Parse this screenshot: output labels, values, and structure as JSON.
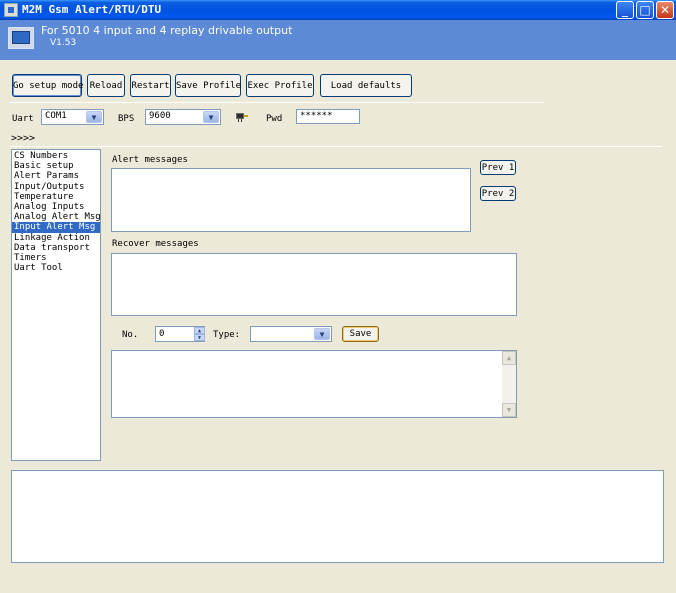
{
  "window": {
    "title": "M2M Gsm Alert/RTU/DTU",
    "minimize": "_",
    "maximize": "□",
    "close": "✕"
  },
  "header": {
    "title": "For 5010 4 input and 4 replay drivable output",
    "version": "V1.53"
  },
  "toolbar": {
    "go_setup_mode": "Go setup mode",
    "reload": "Reload",
    "restart": "Restart",
    "save_profile": "Save Profile",
    "exec_profile": "Exec Profile",
    "load_defaults": "Load defaults"
  },
  "connection": {
    "uart_label": "Uart",
    "uart_value": "COM1",
    "bps_label": "BPS",
    "bps_value": "9600",
    "pwd_label": "Pwd",
    "pwd_value": "******",
    "status_text": ">>>>"
  },
  "menu": {
    "items": [
      "CS Numbers",
      "Basic setup",
      "Alert Params",
      "Input/Outputs",
      "Temperature",
      "Analog Inputs",
      "Analog Alert Msg",
      "Input Alert Msg",
      "Linkage Action",
      "Data transport",
      "Timers",
      "Uart Tool"
    ],
    "selected": "Input Alert Msg"
  },
  "panel": {
    "alert_messages_label": "Alert messages",
    "alert_messages_value": "",
    "recover_messages_label": "Recover messages",
    "recover_messages_value": "",
    "prev1": "Prev 1",
    "prev2": "Prev 2",
    "no_label": "No.",
    "no_value": "0",
    "type_label": "Type:",
    "type_value": "",
    "save": "Save",
    "list_value": ""
  },
  "log": {
    "value": ""
  },
  "colors": {
    "window_bg": "#ECE9D8",
    "header_bg": "#5C8AD6",
    "title_bar": "#0053E0",
    "selection": "#316AC5"
  },
  "icons": {
    "app": "app-window-icon",
    "header": "device-icon",
    "connect": "serial-connect-icon"
  }
}
